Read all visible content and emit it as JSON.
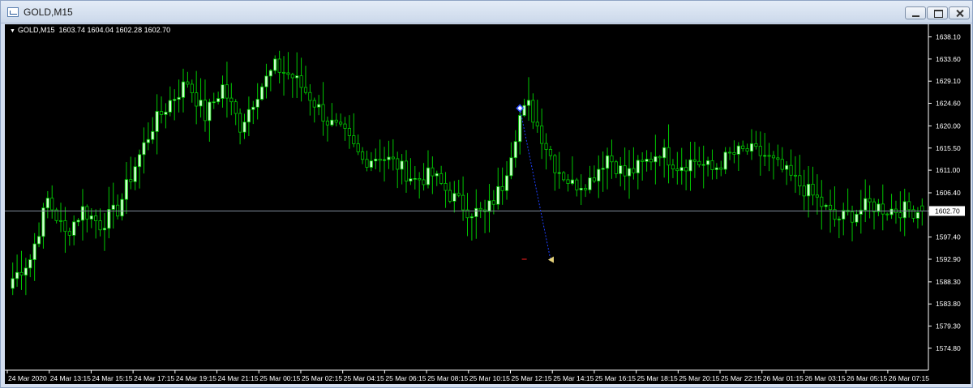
{
  "window": {
    "title": "GOLD,M15",
    "icon": "chart-window-icon",
    "buttons": [
      "minimize-icon",
      "maximize-icon",
      "close-icon"
    ]
  },
  "chart_header": {
    "symbol": "GOLD,M15",
    "ohlc": "1603.74 1604.04 1602.28 1602.70"
  },
  "colors": {
    "background": "#000000",
    "candle_up_fill": "#ccffcc",
    "candle_wick": "#00c800",
    "candle_down_fill": "#000000",
    "axis": "#ffffff",
    "bid_line": "#7f8a99",
    "price_tag_bg": "#ffffff",
    "trend_line": "#1e40ff"
  },
  "chart_data": {
    "type": "candlestick",
    "title": "",
    "xlabel": "",
    "ylabel": "",
    "ylim": [
      1570.5,
      1640.0
    ],
    "y_ticks": [
      "1638.10",
      "1633.60",
      "1629.10",
      "1624.60",
      "1620.00",
      "1615.50",
      "1611.00",
      "1606.40",
      "1602.70",
      "1597.40",
      "1592.90",
      "1588.30",
      "1583.80",
      "1579.30",
      "1574.80"
    ],
    "y_tick_values": [
      1638.1,
      1633.6,
      1629.1,
      1624.6,
      1620.0,
      1615.5,
      1611.0,
      1606.4,
      1602.7,
      1597.4,
      1592.9,
      1588.3,
      1583.8,
      1579.3,
      1574.8
    ],
    "x_ticks": [
      "24 Mar 2020",
      "24 Mar 13:15",
      "24 Mar 15:15",
      "24 Mar 17:15",
      "24 Mar 19:15",
      "24 Mar 21:15",
      "25 Mar 00:15",
      "25 Mar 02:15",
      "25 Mar 04:15",
      "25 Mar 06:15",
      "25 Mar 08:15",
      "25 Mar 10:15",
      "25 Mar 12:15",
      "25 Mar 14:15",
      "25 Mar 16:15",
      "25 Mar 18:15",
      "25 Mar 20:15",
      "25 Mar 22:15",
      "26 Mar 01:15",
      "26 Mar 03:15",
      "26 Mar 05:15",
      "26 Mar 07:15"
    ],
    "current_price": "1602.70",
    "last_bar_ohlc": {
      "open": 1603.74,
      "high": 1604.04,
      "low": 1602.28,
      "close": 1602.7
    },
    "anchor_closes": [
      [
        0,
        1589
      ],
      [
        4,
        1593
      ],
      [
        8,
        1605
      ],
      [
        12,
        1598
      ],
      [
        16,
        1603
      ],
      [
        20,
        1600
      ],
      [
        24,
        1603
      ],
      [
        28,
        1612
      ],
      [
        32,
        1620
      ],
      [
        36,
        1625
      ],
      [
        40,
        1629
      ],
      [
        44,
        1622
      ],
      [
        48,
        1628
      ],
      [
        52,
        1620
      ],
      [
        56,
        1627
      ],
      [
        60,
        1632
      ],
      [
        64,
        1630
      ],
      [
        68,
        1626
      ],
      [
        72,
        1621
      ],
      [
        76,
        1618
      ],
      [
        80,
        1613
      ],
      [
        84,
        1614
      ],
      [
        88,
        1612
      ],
      [
        92,
        1609
      ],
      [
        96,
        1610
      ],
      [
        100,
        1606
      ],
      [
        104,
        1603
      ],
      [
        108,
        1602
      ],
      [
        112,
        1608
      ],
      [
        116,
        1622
      ],
      [
        118,
        1624
      ],
      [
        120,
        1620
      ],
      [
        124,
        1612
      ],
      [
        128,
        1608
      ],
      [
        132,
        1609
      ],
      [
        136,
        1614
      ],
      [
        140,
        1610
      ],
      [
        144,
        1612
      ],
      [
        148,
        1615
      ],
      [
        152,
        1612
      ],
      [
        156,
        1613
      ],
      [
        160,
        1611
      ],
      [
        164,
        1614
      ],
      [
        168,
        1615
      ],
      [
        172,
        1614
      ],
      [
        176,
        1611
      ],
      [
        180,
        1608
      ],
      [
        184,
        1605
      ],
      [
        188,
        1601
      ],
      [
        192,
        1602
      ],
      [
        196,
        1604
      ],
      [
        200,
        1603
      ],
      [
        204,
        1603
      ],
      [
        208,
        1602.7
      ]
    ],
    "bar_count": 209,
    "markers": [
      {
        "name": "trade-entry-marker",
        "bar": 116,
        "price": 1623.6,
        "color": "#3050ff"
      },
      {
        "name": "trade-exit-marker",
        "bar": 123,
        "price": 1592.8,
        "color": "#e6d27a"
      },
      {
        "name": "stop-level-marker",
        "bar": 117,
        "price": 1592.9,
        "color": "#ff2020"
      }
    ],
    "grid": false,
    "legend": "none"
  }
}
